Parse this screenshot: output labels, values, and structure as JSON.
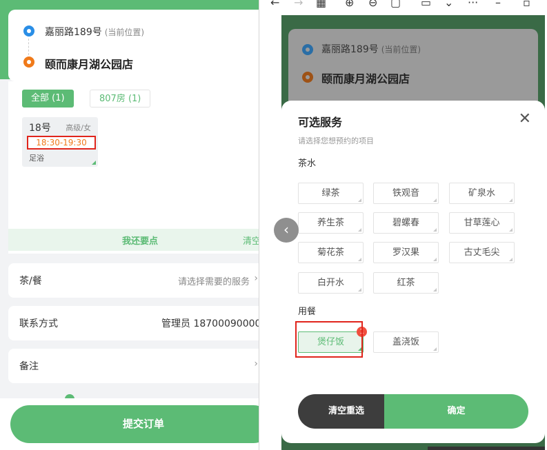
{
  "left": {
    "address": {
      "current": "嘉丽路189号",
      "current_note": "(当前位置)",
      "store": "颐而康月湖公园店"
    },
    "tabs": [
      {
        "label": "全部 (1)"
      },
      {
        "label": "807房 (1)"
      }
    ],
    "technician": {
      "number": "18号",
      "level": "高级/女",
      "time": "18:30-19:30",
      "service": "足浴"
    },
    "more": {
      "add_label": "我还要点",
      "clear_label": "清空"
    },
    "rows": {
      "tea_meal": {
        "label": "茶/餐",
        "value": "请选择需要的服务"
      },
      "contact": {
        "label": "联系方式",
        "value": "管理员 18700090000"
      },
      "remark": {
        "label": "备注"
      }
    },
    "submit_label": "提交订单"
  },
  "toolbar_icons": [
    "back-arrow-icon",
    "forward-arrow-icon",
    "grid-icon",
    "zoom-in-icon",
    "zoom-out-icon",
    "fit-icon",
    "rotate-icon",
    "chevron-down-icon",
    "more-icon",
    "minimize-icon",
    "maximize-icon",
    "close-icon"
  ],
  "right": {
    "address": {
      "current": "嘉丽路189号",
      "current_note": "(当前位置)",
      "store": "颐而康月湖公园店"
    },
    "sheet": {
      "title": "可选服务",
      "hint": "请选择您想预约的项目",
      "categories": [
        {
          "name": "茶水",
          "items": [
            "绿茶",
            "铁观音",
            "矿泉水",
            "养生茶",
            "碧螺春",
            "甘草莲心",
            "菊花茶",
            "罗汉果",
            "古丈毛尖",
            "白开水",
            "红茶"
          ]
        },
        {
          "name": "用餐",
          "items": [
            "煲仔饭",
            "盖浇饭"
          ]
        }
      ],
      "selected_badge": "1",
      "clear_label": "清空重选",
      "confirm_label": "确定"
    }
  },
  "colors": {
    "accent": "#5cbb75",
    "highlight": "#e0241b",
    "orange": "#f07a1a",
    "blue": "#2a8ee6"
  }
}
